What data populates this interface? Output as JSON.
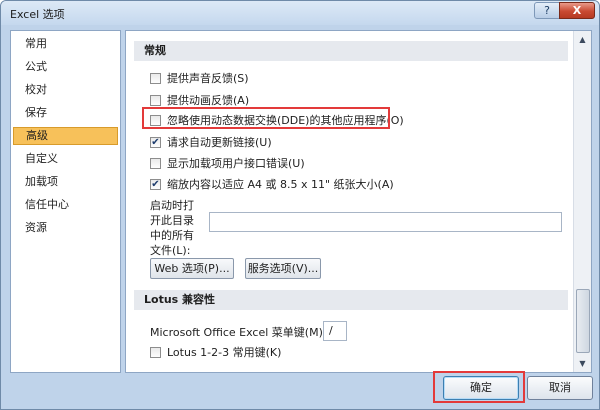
{
  "window": {
    "title": "Excel 选项",
    "help": "?",
    "close": "X"
  },
  "sidebar": {
    "items": [
      {
        "label": "常用"
      },
      {
        "label": "公式"
      },
      {
        "label": "校对"
      },
      {
        "label": "保存"
      },
      {
        "label": "高级",
        "active": true
      },
      {
        "label": "自定义"
      },
      {
        "label": "加载项"
      },
      {
        "label": "信任中心"
      },
      {
        "label": "资源"
      }
    ]
  },
  "general": {
    "header": "常规",
    "options": [
      {
        "label": "提供声音反馈(S)",
        "checked": false
      },
      {
        "label": "提供动画反馈(A)",
        "checked": false
      },
      {
        "label": "忽略使用动态数据交换(DDE)的其他应用程序(O)",
        "checked": false
      },
      {
        "label": "请求自动更新链接(U)",
        "checked": true
      },
      {
        "label": "显示加载项用户接口错误(U)",
        "checked": false
      },
      {
        "label": "缩放内容以适应 A4 或 8.5 x 11\" 纸张大小(A)",
        "checked": true
      }
    ],
    "startup_label": "启动时打开此目录中的所有文件(L):",
    "startup_value": "",
    "web_options": "Web 选项(P)...",
    "service_options": "服务选项(V)..."
  },
  "lotus": {
    "header": "Lotus 兼容性",
    "menu_key_label": "Microsoft Office Excel 菜单键(M):",
    "menu_key_value": "/",
    "nav_keys_label": "Lotus 1-2-3 常用键(K)",
    "nav_keys_checked": false
  },
  "footer": {
    "ok": "确定",
    "cancel": "取消"
  }
}
